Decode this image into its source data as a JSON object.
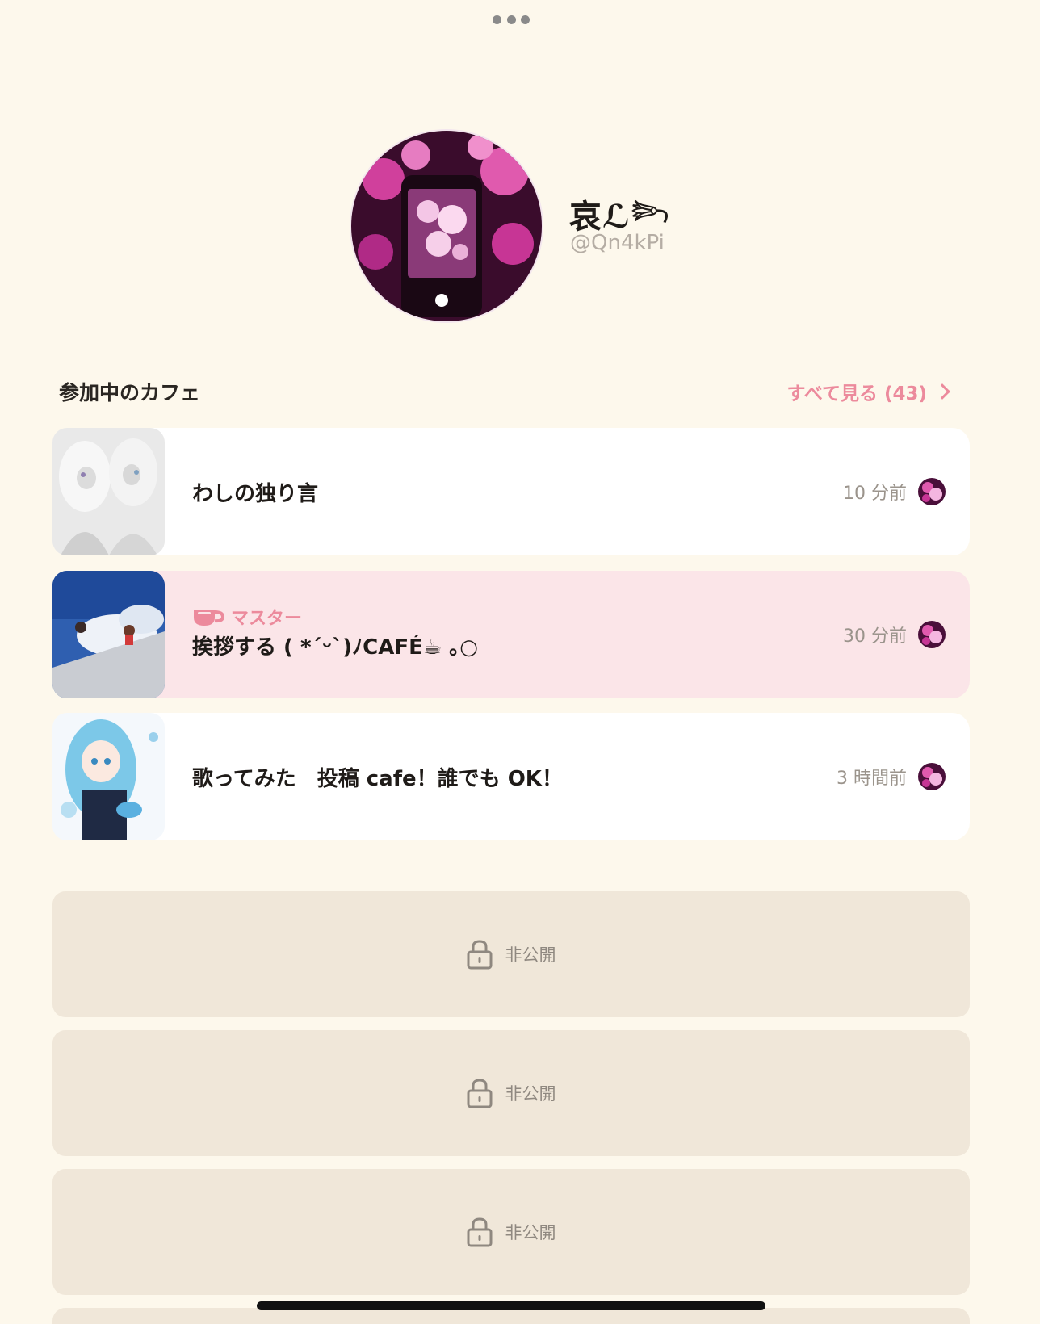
{
  "profile": {
    "name": "哀ℒ𓆸",
    "handle": "@Qn4kPi"
  },
  "cafes_section": {
    "title": "参加中のカフェ",
    "see_all": "すべて見る (43)"
  },
  "cafes": [
    {
      "name": "わしの独り言",
      "time": "10 分前",
      "role": ""
    },
    {
      "name": "挨拶する ( *´ᵕ`)ﾉCAFÉ☕ ｡○",
      "time": "30 分前",
      "role": "マスター"
    },
    {
      "name": "歌ってみた　投稿 cafe！誰でも OK！",
      "time": "3 時間前",
      "role": ""
    }
  ],
  "private_cards": [
    {
      "label": "非公開"
    },
    {
      "label": "非公開"
    },
    {
      "label": "非公開"
    }
  ],
  "colors": {
    "background": "#fdf8ec",
    "accent": "#ec8a9c",
    "master_card": "#fbe5e8",
    "private_card": "#f0e7d9"
  },
  "icons": [
    "more-icon",
    "chevron-right-icon",
    "coffee-cup-icon",
    "lock-icon"
  ]
}
